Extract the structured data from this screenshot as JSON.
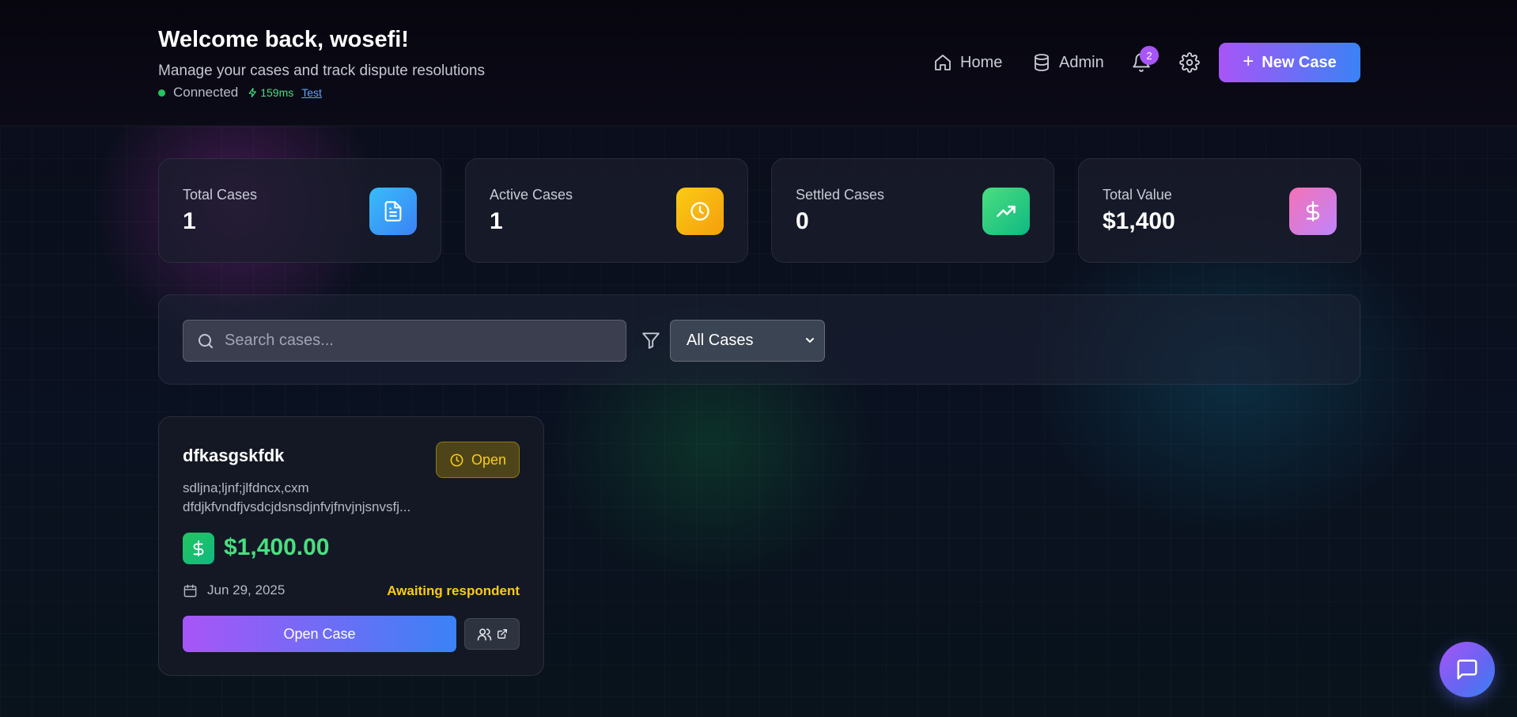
{
  "header": {
    "welcome": "Welcome back, wosefi!",
    "subtitle": "Manage your cases and track dispute resolutions",
    "status": {
      "connected": "Connected",
      "latency": "159ms",
      "test_link": "Test"
    },
    "nav": {
      "home": "Home",
      "admin": "Admin"
    },
    "notifications_count": "2",
    "new_case": "New Case"
  },
  "stats": [
    {
      "label": "Total Cases",
      "value": "1",
      "icon": "document-icon",
      "color": "#38bdf8"
    },
    {
      "label": "Active Cases",
      "value": "1",
      "icon": "clock-icon",
      "color": "#f59e0b"
    },
    {
      "label": "Settled Cases",
      "value": "0",
      "icon": "trending-up-icon",
      "color": "#22c55e"
    },
    {
      "label": "Total Value",
      "value": "$1,400",
      "icon": "dollar-icon",
      "color": "#e879f9"
    }
  ],
  "filters": {
    "search_placeholder": "Search cases...",
    "select_value": "All Cases"
  },
  "case": {
    "title": "dfkasgskfdk",
    "status": "Open",
    "description_line1": "sdljna;ljnf;jlfdncx,cxm",
    "description_line2": "dfdjkfvndfjvsdcjdsnsdjnfvjfnvjnjsnvsfj...",
    "amount": "$1,400.00",
    "date": "Jun 29, 2025",
    "state": "Awaiting respondent",
    "open_button": "Open Case"
  },
  "colors": {
    "accent_from": "#a855f7",
    "accent_to": "#3b82f6",
    "success": "#4ade80",
    "warning": "#facc15"
  }
}
